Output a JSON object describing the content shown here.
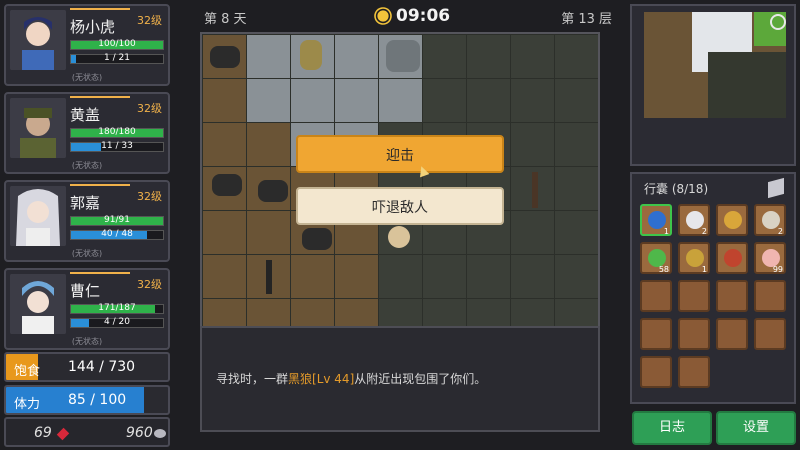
{
  "party": [
    {
      "name": "杨小虎",
      "level": "32级",
      "hp": {
        "text": "100/100",
        "frac": 1.0
      },
      "mp": {
        "text": "1 / 21",
        "frac": 0.05
      },
      "status": "(无状态)"
    },
    {
      "name": "黄盖",
      "level": "32级",
      "hp": {
        "text": "180/180",
        "frac": 1.0
      },
      "mp": {
        "text": "11 / 33",
        "frac": 0.33
      },
      "status": "(无状态)"
    },
    {
      "name": "郭嘉",
      "level": "32级",
      "hp": {
        "text": "91/91",
        "frac": 1.0
      },
      "mp": {
        "text": "40 / 48",
        "frac": 0.83
      },
      "status": "(无状态)"
    },
    {
      "name": "曹仁",
      "level": "32级",
      "hp": {
        "text": "171/187",
        "frac": 0.91
      },
      "mp": {
        "text": "4 / 20",
        "frac": 0.2
      },
      "status": "(无状态)"
    }
  ],
  "stats": {
    "food": {
      "label": "饱食",
      "value": "144 / 730",
      "frac": 0.197
    },
    "stamina": {
      "label": "体力",
      "value": "85 / 100",
      "frac": 0.85
    }
  },
  "currency": {
    "gems": "69",
    "coins": "960"
  },
  "topbar": {
    "day": "第 8 天",
    "time": "09:06",
    "floor": "第 13 层"
  },
  "event": {
    "attack_label": "迎击",
    "scare_label": "吓退敌人",
    "message_prefix": "寻找时，一群",
    "enemy": "黑狼[Lv 44]",
    "message_suffix": "从附近出现包围了你们。"
  },
  "bag": {
    "title": "行囊 (8/18)",
    "items": [
      {
        "icon": "blue-flower-icon",
        "color": "#2f6fd0",
        "count": "1",
        "selected": true
      },
      {
        "icon": "white-flower-icon",
        "color": "#e6e6ea",
        "count": "2"
      },
      {
        "icon": "gold-ore-icon",
        "color": "#d9a63a",
        "count": ""
      },
      {
        "icon": "feather-icon",
        "color": "#d9d2c4",
        "count": "2"
      },
      {
        "icon": "green-leaf-icon",
        "color": "#4fb84a",
        "count": "58"
      },
      {
        "icon": "wheat-icon",
        "color": "#c9a23a",
        "count": "1"
      },
      {
        "icon": "red-root-icon",
        "color": "#c0442e",
        "count": ""
      },
      {
        "icon": "peach-icon",
        "color": "#f0b5b0",
        "count": "99"
      }
    ],
    "empty_slots": 10
  },
  "buttons": {
    "log": "日志",
    "settings": "设置"
  }
}
